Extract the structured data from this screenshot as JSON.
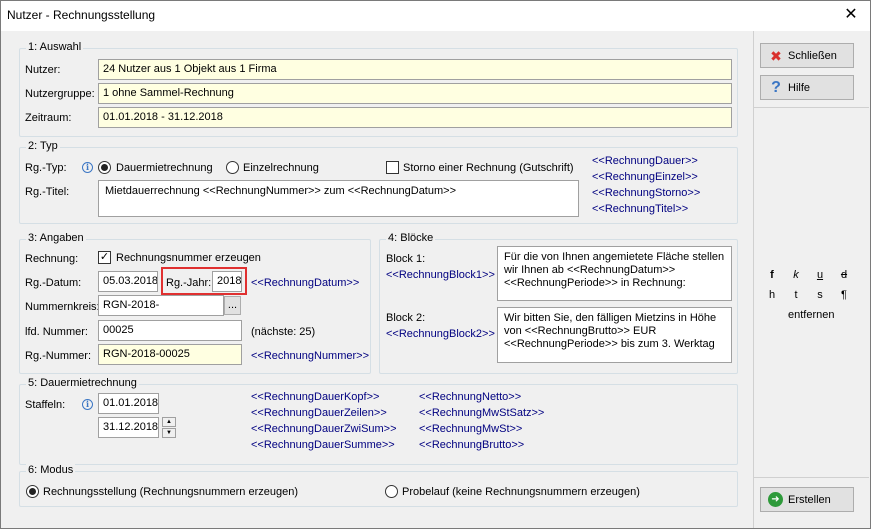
{
  "window": {
    "title": "Nutzer - Rechnungsstellung",
    "close": "✕"
  },
  "auswahl": {
    "legend": "1: Auswahl",
    "nutzer_label": "Nutzer:",
    "nutzer_value": "24 Nutzer aus 1 Objekt aus 1 Firma",
    "gruppe_label": "Nutzergruppe:",
    "gruppe_value": "1 ohne Sammel-Rechnung",
    "zeitraum_label": "Zeitraum:",
    "zeitraum_value": "01.01.2018 - 31.12.2018"
  },
  "typ": {
    "legend": "2: Typ",
    "rg_typ_label": "Rg.-Typ:",
    "radio_dauer": "Dauermietrechnung",
    "radio_einzel": "Einzelrechnung",
    "storno_label": "Storno einer Rechnung (Gutschrift)",
    "rg_titel_label": "Rg.-Titel:",
    "rg_titel_value": "Mietdauerrechnung <<RechnungNummer>> zum <<RechnungDatum>>",
    "tags": [
      "<<RechnungDauer>>",
      "<<RechnungEinzel>>",
      "<<RechnungStorno>>",
      "<<RechnungTitel>>"
    ]
  },
  "angaben": {
    "legend": "3: Angaben",
    "rechnung_label": "Rechnung:",
    "nummer_erzeugen": "Rechnungsnummer erzeugen",
    "datum_label": "Rg.-Datum:",
    "datum_value": "05.03.2018",
    "jahr_label": "Rg.-Jahr:",
    "jahr_value": "2018",
    "datum_tag": "<<RechnungDatum>>",
    "kreis_label": "Nummernkreis:",
    "kreis_value": "RGN-2018-",
    "kreis_button": "...",
    "lfd_label": "lfd. Nummer:",
    "lfd_value": "00025",
    "naechste": "(nächste: 25)",
    "rg_nummer_label": "Rg.-Nummer:",
    "rg_nummer_value": "RGN-2018-00025",
    "rg_nummer_tag": "<<RechnungNummer>>"
  },
  "bloecke": {
    "legend": "4: Blöcke",
    "block1_label": "Block 1:",
    "block1_tag": "<<RechnungBlock1>>",
    "block1_text": "Für die von Ihnen angemietete Fläche stellen\nwir Ihnen ab <<RechnungDatum>>\n<<RechnungPeriode>> in Rechnung:",
    "block2_label": "Block 2:",
    "block2_tag": "<<RechnungBlock2>>",
    "block2_text": "Wir bitten Sie, den fälligen Mietzins in Höhe\nvon <<RechnungBrutto>> EUR\n<<RechnungPeriode>> bis zum 3. Werktag"
  },
  "dauer": {
    "legend": "5: Dauermietrechnung",
    "staffeln_label": "Staffeln:",
    "staffel1": "01.01.2018",
    "staffel2": "31.12.2018",
    "tags_left": [
      "<<RechnungDauerKopf>>",
      "<<RechnungDauerZeilen>>",
      "<<RechnungDauerZwiSum>>",
      "<<RechnungDauerSumme>>"
    ],
    "tags_right": [
      "<<RechnungNetto>>",
      "<<RechnungMwStSatz>>",
      "<<RechnungMwSt>>",
      "<<RechnungBrutto>>"
    ]
  },
  "modus": {
    "legend": "6: Modus",
    "radio_stellung": "Rechnungsstellung (Rechnungsnummern erzeugen)",
    "radio_probe": "Probelauf (keine Rechnungsnummern erzeugen)"
  },
  "buttons": {
    "schliessen": "Schließen",
    "hilfe": "Hilfe",
    "erstellen": "Erstellen"
  },
  "format": {
    "row1": [
      "f",
      "k",
      "u",
      "d"
    ],
    "row2": [
      "h",
      "t",
      "s",
      "¶"
    ],
    "entfernen": "entfernen"
  },
  "colors": {
    "tag": "#000080",
    "field_yellow": "#ffffe1",
    "highlight": "#e03030",
    "close_icon": "#d9302c",
    "help_icon": "#3b76c4",
    "create_icon": "#2e9a3a"
  }
}
